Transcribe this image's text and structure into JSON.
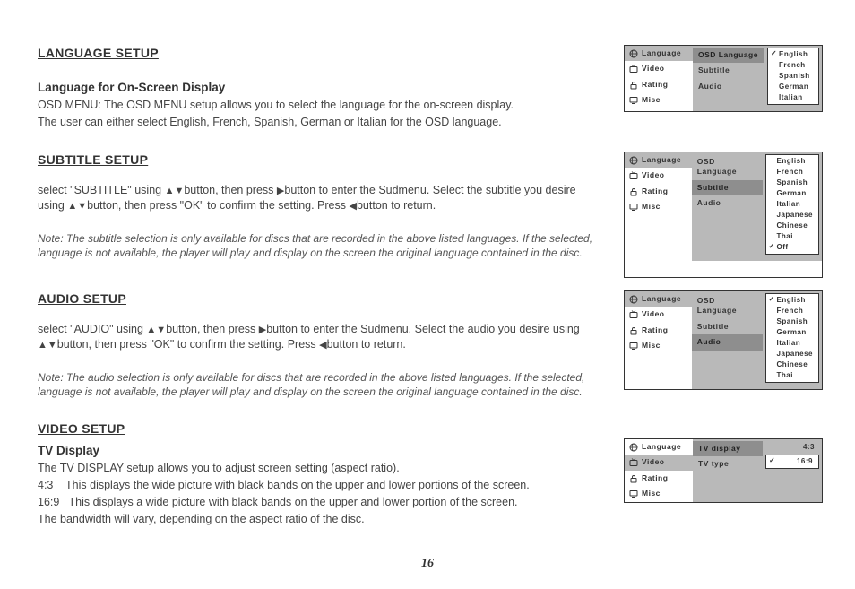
{
  "sections": {
    "language": {
      "heading": "LANGUAGE SETUP",
      "subheading": "Language for On-Screen Display",
      "para1": "OSD MENU: The OSD MENU setup allows you to select the language for the on-screen display.",
      "para2": "The user can either select English, French, Spanish, German or Italian for the OSD language."
    },
    "subtitle": {
      "heading": "SUBTITLE SETUP",
      "para_a": "select \"SUBTITLE\" using ",
      "para_b": "button, then press ",
      "para_c": "button to enter the Sudmenu. Select the subtitle you desire using ",
      "para_d": "button, then press \"OK\" to confirm the setting. Press ",
      "para_e": "button to return.",
      "note": "Note: The subtitle selection is only available for discs that are recorded in the above listed languages. If the selected, language is not available, the player will play and display on the screen the original language contained in the disc."
    },
    "audio": {
      "heading": "AUDIO SETUP",
      "para_a": "select \"AUDIO\" using ",
      "para_b": "button, then press ",
      "para_c": "button to enter the Sudmenu. Select the audio you desire using ",
      "para_d": "button, then press \"OK\" to confirm the setting. Press ",
      "para_e": "button to return.",
      "note": "Note: The audio selection is only available for discs that are recorded in the above listed languages. If the selected, language is not available, the player will play and display on the screen the original language contained in the disc."
    },
    "video": {
      "heading": "VIDEO SETUP",
      "subheading": "TV Display",
      "p1": "The TV DISPLAY setup allows you to adjust screen setting (aspect ratio).",
      "p2": "4:3    This displays the wide picture with black bands on the upper and lower portions of the screen.",
      "p3": "16:9   This displays a wide picture with black bands on the upper and lower portion of the screen.",
      "p4": "The bandwidth will vary, depending on the aspect ratio of the disc."
    }
  },
  "glyphs": {
    "updown": "▲▼",
    "right": "▶",
    "left": "◀"
  },
  "menu_left": {
    "language": "Language",
    "video": "Video",
    "rating": "Rating",
    "misc": "Misc"
  },
  "menu_mid": {
    "osd_language": "OSD Language",
    "subtitle": "Subtitle",
    "audio": "Audio",
    "tv_display": "TV display",
    "tv_type": "TV type"
  },
  "langs5": [
    "English",
    "French",
    "Spanish",
    "German",
    "Italian"
  ],
  "langs_off": [
    "English",
    "French",
    "Spanish",
    "German",
    "Italian",
    "Japanese",
    "Chinese",
    "Thai",
    "Off"
  ],
  "langs8": [
    "English",
    "French",
    "Spanish",
    "German",
    "Italian",
    "Japanese",
    "Chinese",
    "Thai"
  ],
  "tv_opts": {
    "a": "4:3",
    "b": "16:9"
  },
  "page": "16"
}
